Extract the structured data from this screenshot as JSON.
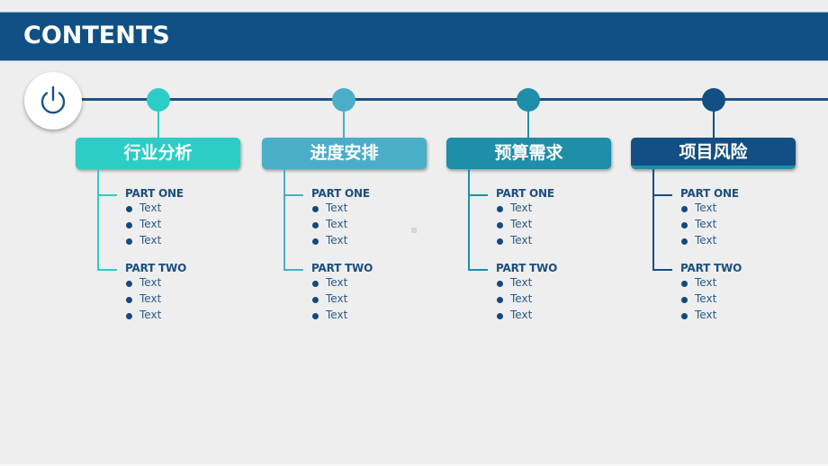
{
  "header": {
    "title": "CONTENTS",
    "background": "#105084"
  },
  "timeline": {
    "line_color": "#1b5385",
    "start_icon": "power-icon"
  },
  "sections": [
    {
      "title": "行业分析",
      "color": "#2ccdc6",
      "parts": [
        {
          "label": "PART ONE",
          "items": [
            "Text",
            "Text",
            "Text"
          ]
        },
        {
          "label": "PART TWO",
          "items": [
            "Text",
            "Text",
            "Text"
          ]
        }
      ]
    },
    {
      "title": "进度安排",
      "color": "#4baec8",
      "parts": [
        {
          "label": "PART ONE",
          "items": [
            "Text",
            "Text",
            "Text"
          ]
        },
        {
          "label": "PART TWO",
          "items": [
            "Text",
            "Text",
            "Text"
          ]
        }
      ]
    },
    {
      "title": "预算需求",
      "color": "#1f8ea9",
      "parts": [
        {
          "label": "PART ONE",
          "items": [
            "Text",
            "Text",
            "Text"
          ]
        },
        {
          "label": "PART TWO",
          "items": [
            "Text",
            "Text",
            "Text"
          ]
        }
      ]
    },
    {
      "title": "项目风险",
      "color": "#124f84",
      "parts": [
        {
          "label": "PART ONE",
          "items": [
            "Text",
            "Text",
            "Text"
          ]
        },
        {
          "label": "PART TWO",
          "items": [
            "Text",
            "Text",
            "Text"
          ]
        }
      ]
    }
  ]
}
